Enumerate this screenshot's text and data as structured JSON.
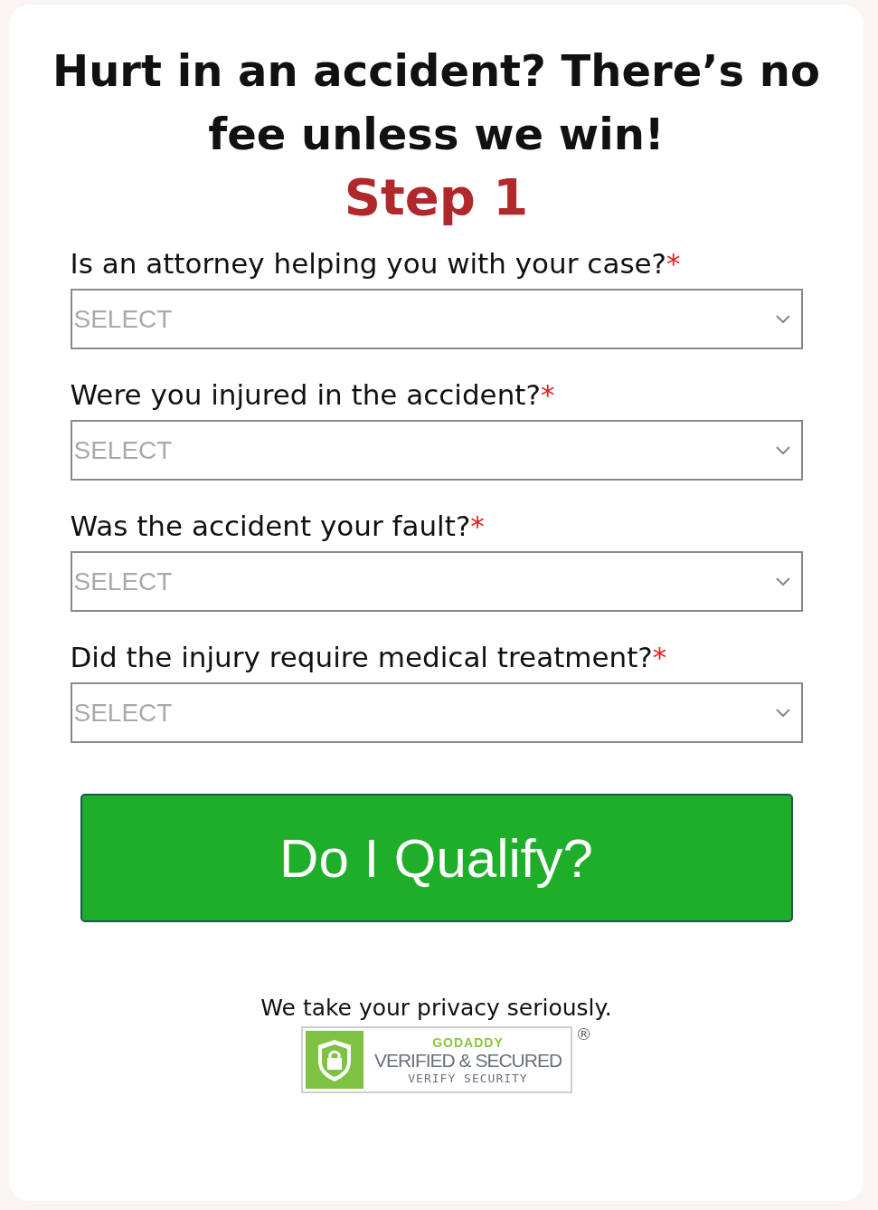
{
  "headline": "Hurt in an accident? There’s no fee unless we win!",
  "step": "Step 1",
  "questions": [
    {
      "label": "Is an attorney helping you with your case?",
      "required_mark": "*",
      "placeholder": "SELECT"
    },
    {
      "label": "Were you injured in the accident?",
      "required_mark": "*",
      "placeholder": "SELECT"
    },
    {
      "label": "Was the accident your fault?",
      "required_mark": "*",
      "placeholder": "SELECT"
    },
    {
      "label": "Did the injury require medical treatment?",
      "required_mark": "*",
      "placeholder": "SELECT"
    }
  ],
  "submit_button": "Do I Qualify?",
  "privacy_note": "We take your privacy seriously.",
  "badge": {
    "brand": "GODADDY",
    "title": "VERIFIED & SECURED",
    "subtitle": "VERIFY SECURITY",
    "registered_mark": "®"
  }
}
